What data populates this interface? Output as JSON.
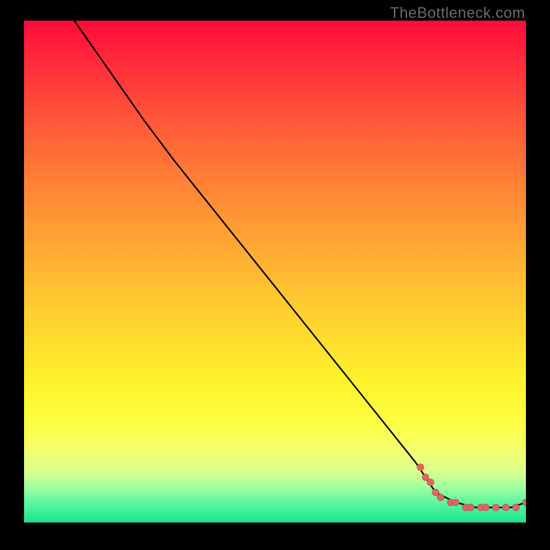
{
  "watermark": "TheBottleneck.com",
  "chart_data": {
    "type": "line",
    "title": "",
    "xlabel": "",
    "ylabel": "",
    "xlim": [
      0,
      100
    ],
    "ylim": [
      0,
      100
    ],
    "grid": false,
    "curve": [
      {
        "x": 10,
        "y": 100
      },
      {
        "x": 24,
        "y": 80
      },
      {
        "x": 30,
        "y": 72
      },
      {
        "x": 78,
        "y": 12
      },
      {
        "x": 82,
        "y": 6
      },
      {
        "x": 86,
        "y": 4
      },
      {
        "x": 90,
        "y": 3
      },
      {
        "x": 94,
        "y": 3
      },
      {
        "x": 97,
        "y": 3
      },
      {
        "x": 100,
        "y": 4
      }
    ],
    "points": [
      {
        "x": 79,
        "y": 11
      },
      {
        "x": 80,
        "y": 9
      },
      {
        "x": 81,
        "y": 8
      },
      {
        "x": 82,
        "y": 6
      },
      {
        "x": 83,
        "y": 5
      },
      {
        "x": 85,
        "y": 4
      },
      {
        "x": 86,
        "y": 4
      },
      {
        "x": 88,
        "y": 3
      },
      {
        "x": 89,
        "y": 3
      },
      {
        "x": 91,
        "y": 3
      },
      {
        "x": 92,
        "y": 3
      },
      {
        "x": 94,
        "y": 3
      },
      {
        "x": 96,
        "y": 3
      },
      {
        "x": 98,
        "y": 3
      },
      {
        "x": 100,
        "y": 4
      }
    ],
    "colors": {
      "curve": "#000000",
      "points": "#e06464",
      "background_top": "#ff0a3a",
      "background_mid": "#fff22c",
      "background_bottom": "#18e58f",
      "frame": "#000000"
    }
  }
}
